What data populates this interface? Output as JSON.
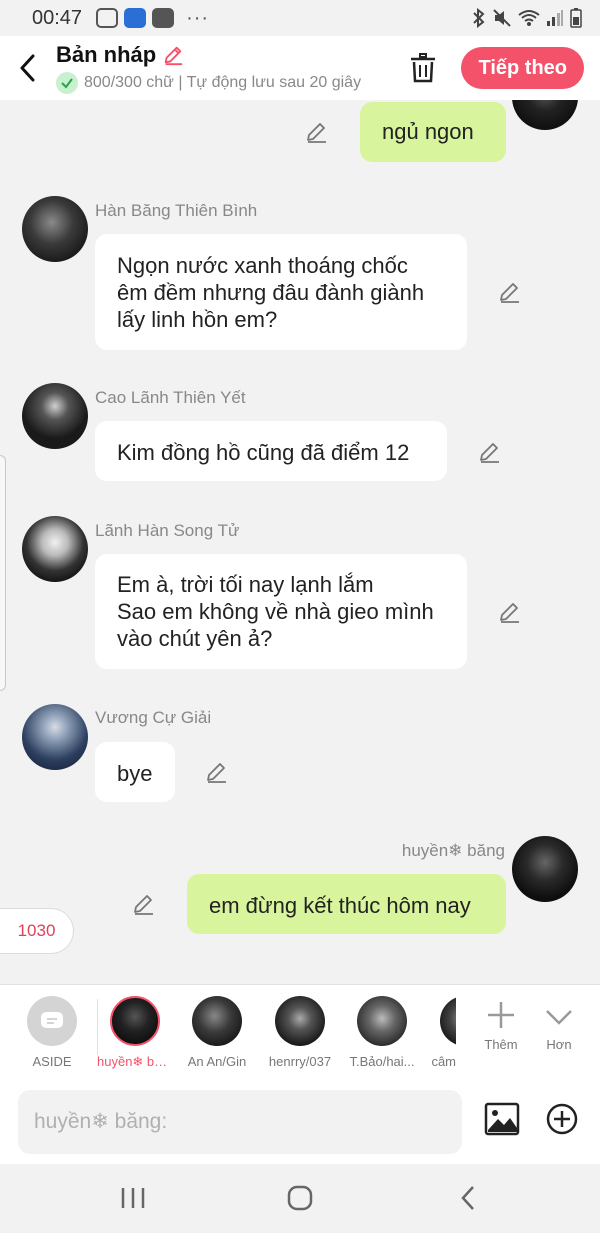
{
  "status_bar": {
    "time": "00:47",
    "more": "···"
  },
  "header": {
    "title": "Bản nháp",
    "subtitle": "800/300 chữ | Tự động lưu sau 20 giây",
    "next_label": "Tiếp theo"
  },
  "messages": [
    {
      "side": "right",
      "name": "",
      "text": "ngủ ngon"
    },
    {
      "side": "left",
      "name": "Hàn Băng Thiên Bình",
      "text": "Ngọn nước xanh thoáng chốc\nêm đềm nhưng đâu đành giành\nlấy linh hồn em?"
    },
    {
      "side": "left",
      "name": "Cao Lãnh Thiên Yết",
      "text": "Kim đồng hồ cũng đã điểm 12"
    },
    {
      "side": "left",
      "name": "Lãnh Hàn Song Tử",
      "text": "Em à, trời tối nay lạnh lắm\nSao em không về nhà gieo mình\nvào chút yên ả?"
    },
    {
      "side": "left",
      "name": "Vương Cự Giải",
      "text": "bye"
    },
    {
      "side": "right",
      "name": "huyền❄ băng",
      "text": "em đừng kết thúc hôm nay"
    }
  ],
  "counter": "1030",
  "characters": [
    {
      "label": "ASIDE"
    },
    {
      "label": "huyền❄ băng",
      "selected": true
    },
    {
      "label": "An An/Gin"
    },
    {
      "label": "henrry/037"
    },
    {
      "label": "T.Bảo/hai..."
    },
    {
      "label": "câm"
    }
  ],
  "strip_actions": {
    "add": "Thêm",
    "more": "Hơn"
  },
  "input": {
    "placeholder": "huyền❄ băng:"
  },
  "colors": {
    "accent": "#f4526a",
    "bubble_self": "#d8f59d",
    "bubble_other": "#ffffff",
    "background": "#f2f2f2"
  }
}
